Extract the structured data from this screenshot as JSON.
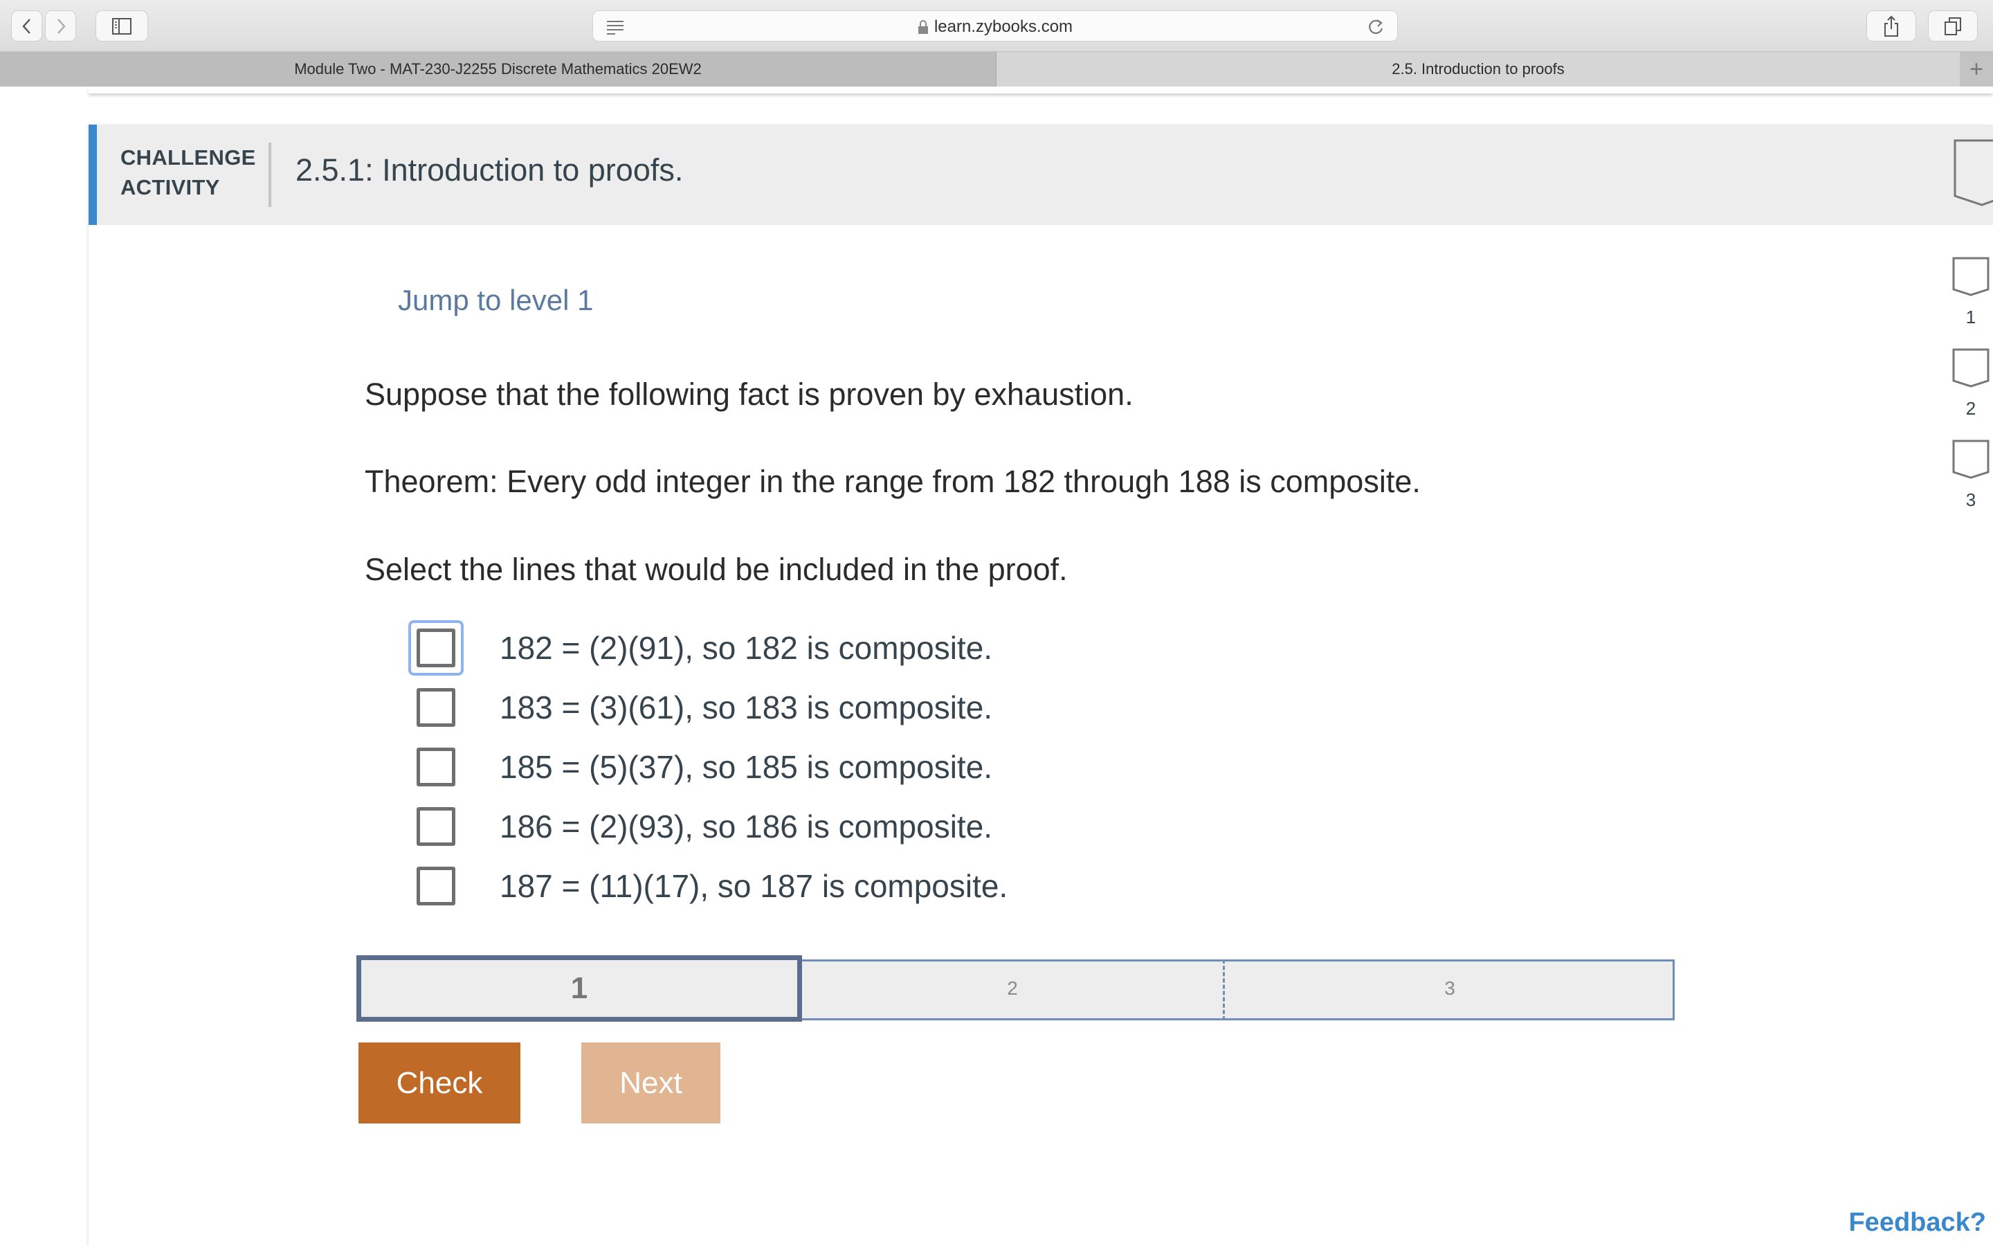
{
  "browser": {
    "url": "learn.zybooks.com",
    "tabs": [
      {
        "label": "Module Two - MAT-230-J2255 Discrete Mathematics 20EW2",
        "active": false
      },
      {
        "label": "2.5. Introduction to proofs",
        "active": true
      }
    ],
    "icons": {
      "back": "chevron-left-icon",
      "forward": "chevron-right-icon",
      "sidebar": "sidebar-icon",
      "reader": "reader-icon",
      "lock": "lock-icon",
      "reload": "reload-icon",
      "share": "share-icon",
      "tabs": "tabs-overview-icon",
      "new_tab": "plus-icon"
    },
    "new_tab_symbol": "+"
  },
  "activity": {
    "type_label_line1": "CHALLENGE",
    "type_label_line2": "ACTIVITY",
    "title": "2.5.1: Introduction to proofs.",
    "accent_color": "#3a87cc",
    "level_markers": [
      "1",
      "2",
      "3"
    ],
    "jump_link": "Jump to level 1",
    "prompt": "Suppose that the following fact is proven by exhaustion.",
    "theorem": "Theorem: Every odd integer in the range from 182 through 188 is composite.",
    "instruction": "Select the lines that would be included in the proof.",
    "options": [
      {
        "text": "182 = (2)(91), so 182 is composite.",
        "checked": false,
        "focused": true
      },
      {
        "text": "183 = (3)(61), so 183 is composite.",
        "checked": false,
        "focused": false
      },
      {
        "text": "185 = (5)(37), so 185 is composite.",
        "checked": false,
        "focused": false
      },
      {
        "text": "186 = (2)(93), so 186 is composite.",
        "checked": false,
        "focused": false
      },
      {
        "text": "187 = (11)(17), so 187 is composite.",
        "checked": false,
        "focused": false
      }
    ],
    "levels": {
      "current": "1",
      "items": [
        "1",
        "2",
        "3"
      ]
    },
    "buttons": {
      "check": "Check",
      "next": "Next"
    },
    "button_colors": {
      "check": "#c06a27",
      "next": "#e1b492"
    }
  },
  "footer": {
    "feedback": "Feedback?"
  }
}
